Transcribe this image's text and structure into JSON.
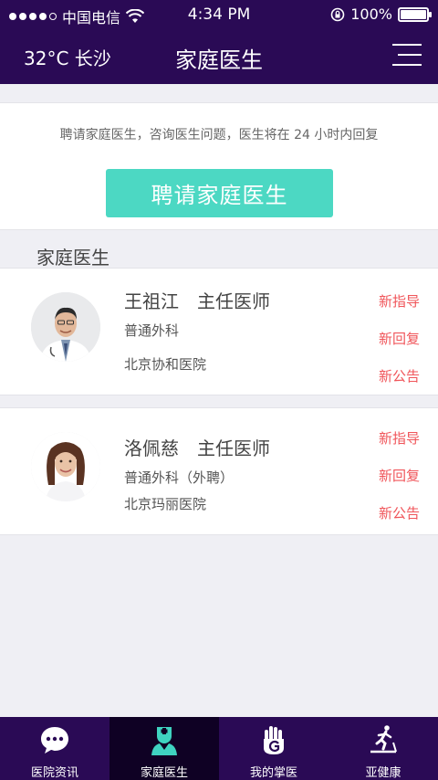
{
  "status_bar": {
    "carrier": "中国电信",
    "time": "4:34 PM",
    "battery": "100%"
  },
  "nav": {
    "weather": "32°C 长沙",
    "title": "家庭医生",
    "menu_icon": "menu-icon"
  },
  "hire": {
    "description": "聘请家庭医生，咨询医生问题，医生将在 24 小时内回复",
    "button_label": "聘请家庭医生"
  },
  "section": {
    "title": "家庭医生"
  },
  "doctors": [
    {
      "name": "王祖江",
      "title": "主任医师",
      "department": "普通外科",
      "hospital": "北京协和医院",
      "tags": [
        "新指导",
        "新回复",
        "新公告"
      ]
    },
    {
      "name": "洛佩慈",
      "title": "主任医师",
      "department": "普通外科（外聘）",
      "hospital": "北京玛丽医院",
      "tags": [
        "新指导",
        "新回复",
        "新公告"
      ]
    }
  ],
  "tabs": [
    {
      "label": "医院资讯",
      "icon": "chat-bubble-icon",
      "active": false
    },
    {
      "label": "家庭医生",
      "icon": "doctor-icon",
      "active": true
    },
    {
      "label": "我的掌医",
      "icon": "hand-icon",
      "active": false
    },
    {
      "label": "亚健康",
      "icon": "treadmill-runner-icon",
      "active": false
    }
  ],
  "colors": {
    "header_bg": "#2a0a55",
    "accent": "#4cd8c3",
    "tag_red": "#f0555a",
    "tab_active_bg": "#0f0124",
    "tab_icon_active": "#3fd3c0"
  }
}
